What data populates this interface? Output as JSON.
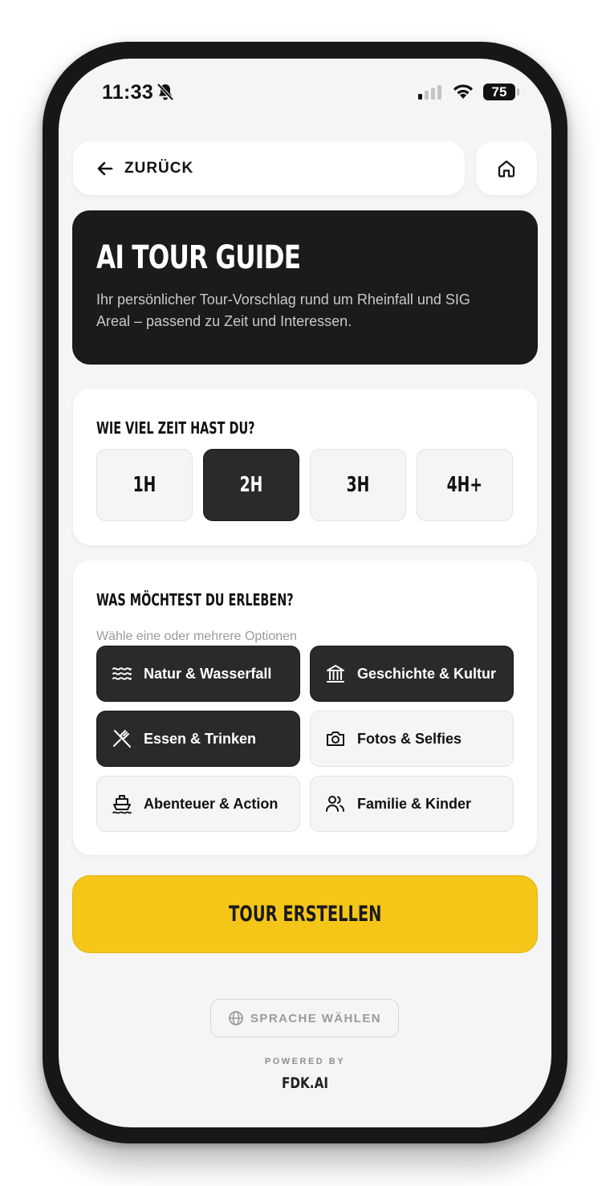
{
  "status_bar": {
    "time": "11:33",
    "battery": "75",
    "icons": [
      "bell-slash-icon",
      "signal-icon",
      "wifi-icon",
      "battery-icon"
    ]
  },
  "nav": {
    "back_label": "ZURÜCK",
    "back_icon": "arrow-left-icon",
    "home_icon": "home-icon"
  },
  "hero": {
    "title": "AI TOUR GUIDE",
    "subtitle": "Ihr persönlicher Tour-Vorschlag rund um Rheinfall und SIG Areal – passend zu Zeit und Interessen."
  },
  "time_section": {
    "title": "WIE VIEL ZEIT HAST DU?",
    "options": [
      {
        "label": "1H",
        "selected": false
      },
      {
        "label": "2H",
        "selected": true
      },
      {
        "label": "3H",
        "selected": false
      },
      {
        "label": "4H+",
        "selected": false
      }
    ]
  },
  "interest_section": {
    "title": "WAS MÖCHTEST DU ERLEBEN?",
    "hint": "Wähle eine oder mehrere Optionen",
    "options": [
      {
        "label": "Natur & Wasserfall",
        "icon": "waves-icon",
        "selected": true
      },
      {
        "label": "Geschichte & Kultur",
        "icon": "museum-icon",
        "selected": true
      },
      {
        "label": "Essen & Trinken",
        "icon": "utensils-icon",
        "selected": true
      },
      {
        "label": "Fotos & Selfies",
        "icon": "camera-icon",
        "selected": false
      },
      {
        "label": "Abenteuer & Action",
        "icon": "boat-icon",
        "selected": false
      },
      {
        "label": "Familie & Kinder",
        "icon": "users-icon",
        "selected": false
      }
    ]
  },
  "cta": {
    "label": "TOUR ERSTELLEN"
  },
  "footer": {
    "language_label": "SPRACHE WÄHLEN",
    "language_icon": "globe-icon",
    "powered_by": "POWERED BY",
    "brand": "FDK.AI"
  },
  "colors": {
    "accent": "#f5c518",
    "dark": "#1b1b1b",
    "chip_active": "#2b2a28",
    "background": "#f5f5f5"
  }
}
